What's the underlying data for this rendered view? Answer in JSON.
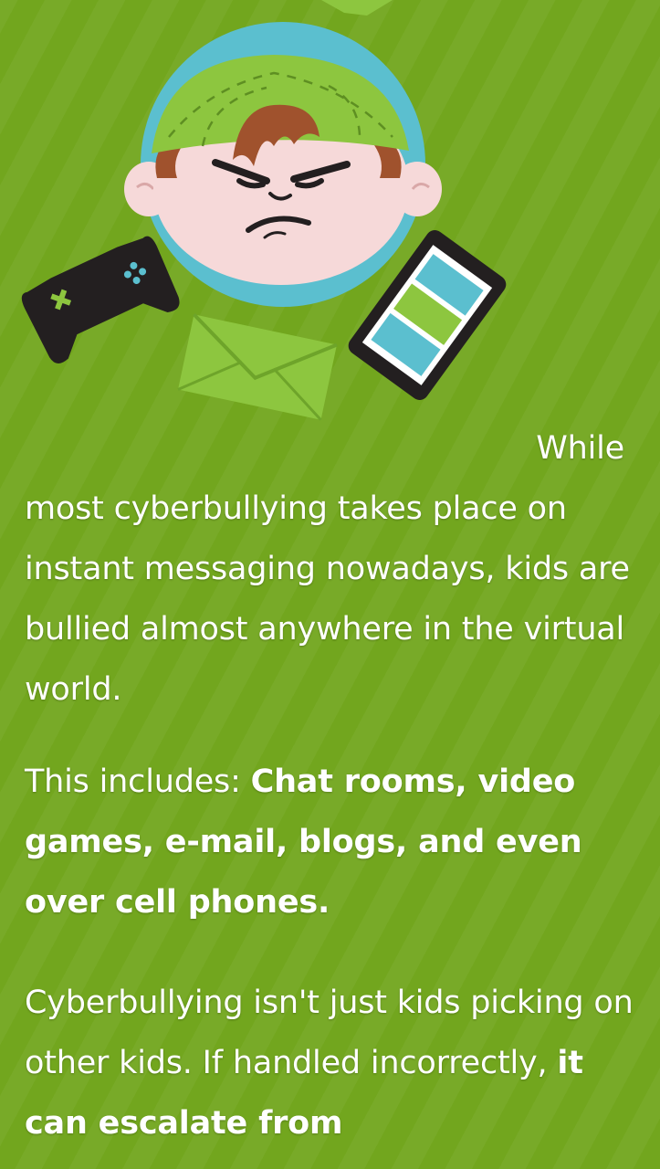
{
  "article": {
    "para1_first": "While",
    "para1_rest": "most cyberbullying takes place on instant messaging nowadays, kids are bullied almost anywhere in the virtual world.",
    "para2_prefix": "This includes: ",
    "para2_bold": "Chat rooms, video games, e-mail, blogs, and even over cell phones.",
    "para3_text": "Cyberbullying isn't just kids picking on other kids. If handled incorrectly, ",
    "para3_bold": "it can escalate from"
  },
  "colors": {
    "background": "#72a61e",
    "circle": "#5bbfcf",
    "cap": "#8dc63f",
    "hair": "#a0522d",
    "face": "#f6d9d9",
    "controller": "#231f20",
    "accent": "#8dc63f"
  }
}
